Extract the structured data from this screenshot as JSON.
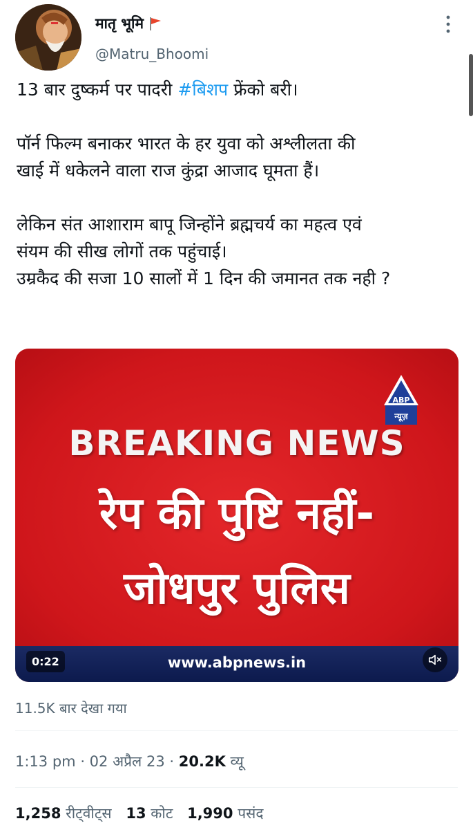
{
  "author": {
    "display_name": "मातृ भूमि",
    "flag_emoji": "flag-icon",
    "handle": "@Matru_Bhoomi"
  },
  "tweet": {
    "line1_prefix": "13 बार दुष्कर्म पर पादरी ",
    "hashtag": "#बिशप",
    "line1_suffix": " फ्रेंको बरी।",
    "line2": "पॉर्न फिल्म बनाकर भारत के हर युवा को अश्लीलता की",
    "line3": "खाई में धकेलने वाला राज कुंद्रा आजाद घूमता हैं।",
    "line4": "लेकिन संत आशाराम बापू जिन्होंने ब्रह्मचर्य का महत्व एवं",
    "line5": "संयम की सीख लोगों तक पहुंचाई।",
    "line6": "उम्रकैद की सजा 10 सालों में 1 दिन की जमानत तक नही ?"
  },
  "media": {
    "logo_text": "ABP",
    "logo_sub": "न्यूज़",
    "breaking": "BREAKING NEWS",
    "headline1": "रेप की पुष्टि नहीं-",
    "headline2": "जोधपुर पुलिस",
    "website": "www.abpnews.in",
    "duration": "0:22",
    "background_color": "#d71920"
  },
  "views_caption": "11.5K बार देखा गया",
  "meta": {
    "time": "1:13 pm",
    "date": "02 अप्रैल 23",
    "views_count": "20.2K",
    "views_label": "व्यू"
  },
  "stats": {
    "retweets_count": "1,258",
    "retweets_label": "रीट्वीट्स",
    "quotes_count": "13",
    "quotes_label": "कोट",
    "likes_count": "1,990",
    "likes_label": "पसंद"
  }
}
